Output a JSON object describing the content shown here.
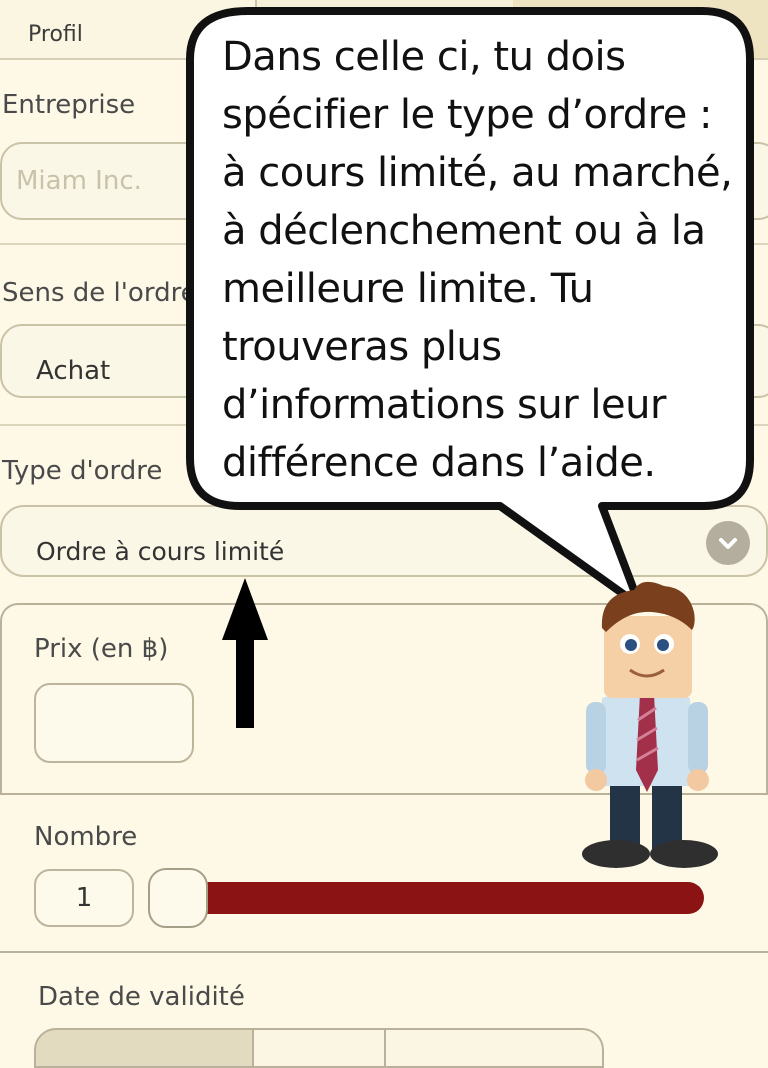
{
  "tabs": {
    "profil_label": "Profil"
  },
  "form": {
    "entreprise_label": "Entreprise",
    "entreprise_placeholder": "Miam Inc.",
    "sens_label": "Sens de l'ordre",
    "sens_value": "Achat",
    "type_label": "Type d'ordre",
    "type_value": "Ordre à cours limité",
    "prix_label": "Prix (en ฿)",
    "prix_value": "",
    "nombre_label": "Nombre",
    "nombre_value": "1",
    "slider_fraction": 0.0,
    "date_label": "Date de validité"
  },
  "tutorial": {
    "lines": [
      "Dans celle ci, tu dois",
      "spécifier le type d’ordre :",
      "à cours limité, au marché,",
      "à déclenchement ou à la",
      "meilleure limite. Tu",
      "trouveras plus",
      "d’informations sur leur",
      "différence dans l’aide."
    ]
  },
  "colors": {
    "accent_slider": "#8b1314",
    "background": "#fdf9e6"
  },
  "icons": {
    "select_arrow": "chevron-down-icon",
    "pointer": "up-arrow-icon",
    "mascot": "businessman-mascot"
  }
}
